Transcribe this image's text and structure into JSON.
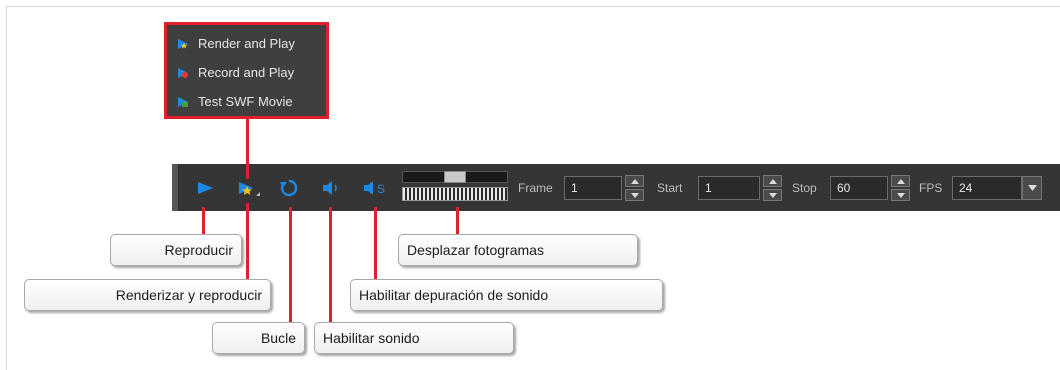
{
  "menu": {
    "items": [
      {
        "label": "Render and Play",
        "icon": "render-play-icon"
      },
      {
        "label": "Record and Play",
        "icon": "record-play-icon"
      },
      {
        "label": "Test SWF Movie",
        "icon": "test-swf-icon"
      }
    ]
  },
  "toolbar": {
    "icons": {
      "play": "play-icon",
      "render_play": "render-play-icon",
      "loop": "loop-icon",
      "sound": "sound-icon",
      "sound_scrub": "sound-scrub-icon"
    },
    "frame": {
      "label": "Frame",
      "value": "1"
    },
    "start": {
      "label": "Start",
      "value": "1"
    },
    "stop": {
      "label": "Stop",
      "value": "60"
    },
    "fps": {
      "label": "FPS",
      "value": "24"
    }
  },
  "callouts": {
    "play": "Reproducir",
    "render_play": "Renderizar y reproducir",
    "loop": "Bucle",
    "sound": "Habilitar sonido",
    "scrub": "Desplazar fotogramas",
    "sound_scrub": "Habilitar depuración de sonido"
  },
  "colors": {
    "accent_red": "#e0202a",
    "toolbar_bg": "#353535",
    "play_blue": "#1e88e5",
    "menu_bg": "#3f3f3f"
  }
}
